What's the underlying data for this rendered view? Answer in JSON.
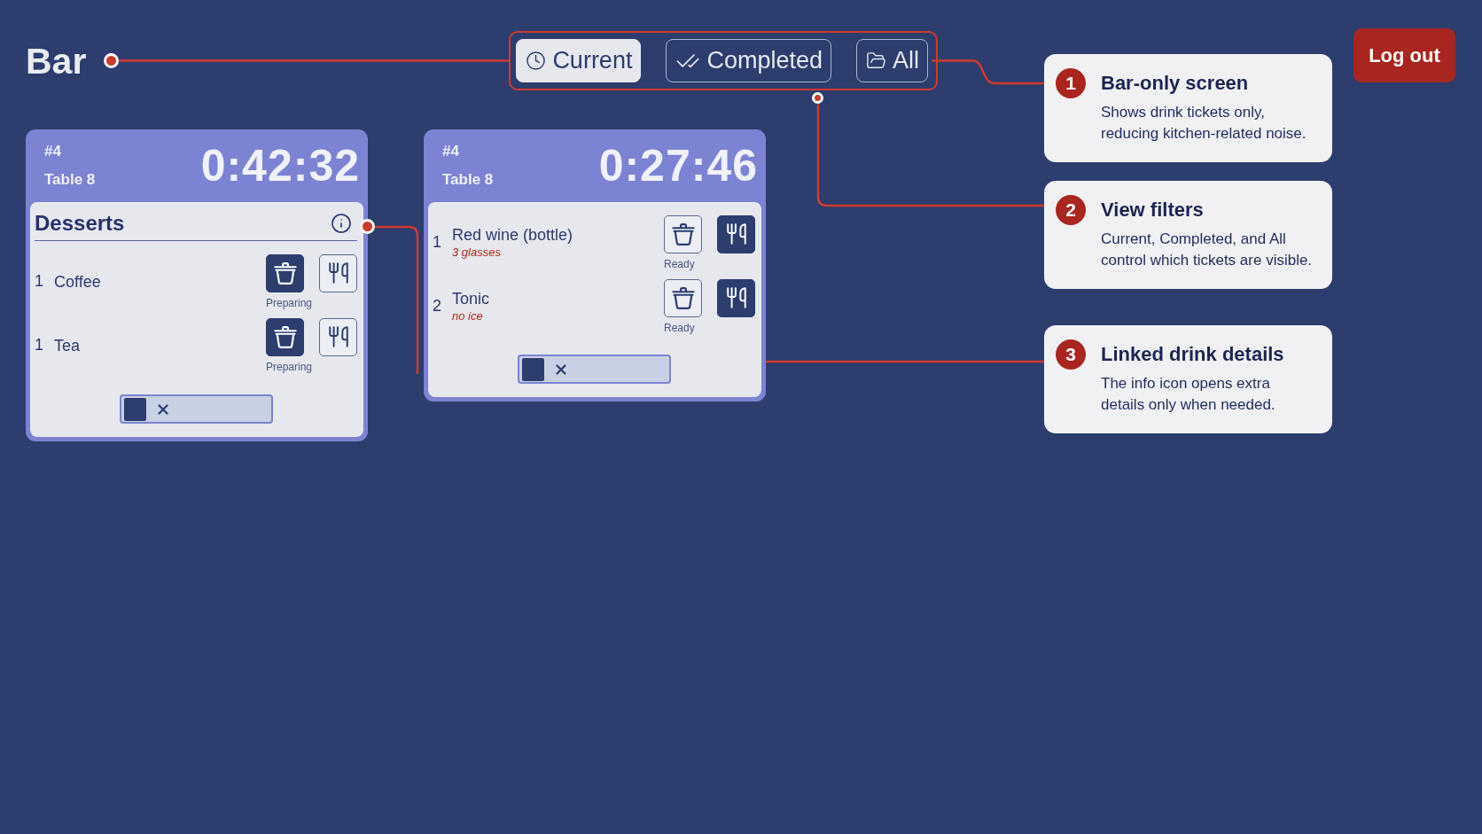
{
  "header": {
    "title": "Bar"
  },
  "filters": [
    {
      "label": "Current",
      "selected": true
    },
    {
      "label": "Completed",
      "selected": false
    },
    {
      "label": "All",
      "selected": false
    }
  ],
  "logout_button": {
    "label": "Log out"
  },
  "tickets": [
    {
      "number": "#4",
      "table": "Table 8",
      "timer": "0:42:32",
      "category": "Desserts",
      "items": [
        {
          "qty": "1",
          "name": "Coffee",
          "status": "Preparing",
          "prep_button": {
            "active": true
          },
          "serve_button": {
            "active": false
          }
        },
        {
          "qty": "1",
          "name": "Tea",
          "status": "Preparing",
          "prep_button": {
            "active": true
          },
          "serve_button": {
            "active": false
          }
        }
      ],
      "switch": {
        "on": false
      }
    },
    {
      "number": "#4",
      "table": "Table 8",
      "timer": "0:27:46",
      "items": [
        {
          "qty": "1",
          "name": "Red wine (bottle)",
          "note": "3 glasses",
          "status": "Ready",
          "prep_button": {
            "active": false
          },
          "serve_button": {
            "active": true
          }
        },
        {
          "qty": "2",
          "name": "Tonic",
          "note": "no ice",
          "status": "Ready",
          "prep_button": {
            "active": false
          },
          "serve_button": {
            "active": true
          }
        }
      ],
      "switch": {
        "on": false
      }
    }
  ],
  "annotations": [
    {
      "number": "1",
      "title": "Bar-only screen",
      "text": "Shows drink tickets only, reducing kitchen-related noise."
    },
    {
      "number": "2",
      "title": "View filters",
      "text": "Current, Completed, and All control which tickets are visible."
    },
    {
      "number": "3",
      "title": "Linked drink details",
      "text": "The info icon opens extra details only when needed."
    }
  ]
}
